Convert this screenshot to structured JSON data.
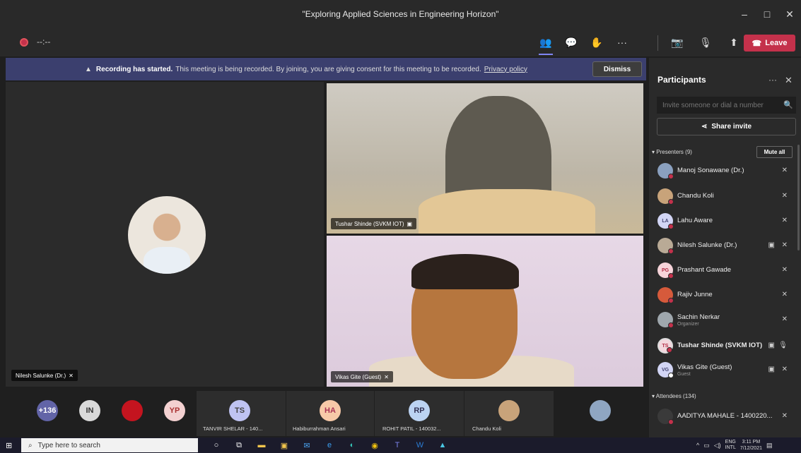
{
  "window": {
    "title": "\"Exploring Applied Sciences in Engineering Horizon\"",
    "minimize": "–",
    "maximize": "□",
    "close": "✕"
  },
  "toolbar": {
    "timer": "--:--",
    "icons": {
      "participants": "👥",
      "chat": "💬",
      "reactions": "✋",
      "more": "···",
      "camera": "📷",
      "mic": "🎙",
      "share": "⬆"
    },
    "leave_label": "Leave"
  },
  "banner": {
    "bold_text": "Recording has started.",
    "text": "This meeting is being recorded. By joining, you are giving consent for this meeting to be recorded.",
    "link": "Privacy policy",
    "dismiss_label": "Dismiss"
  },
  "tiles": {
    "main_name": "Nilesh Salunke (Dr.)",
    "top_right_name": "Tushar Shinde (SVKM IOT)",
    "bottom_right_name": "Vikas Gite (Guest)"
  },
  "strip": {
    "overflow": "+136",
    "in": "IN",
    "yp": "YP",
    "ts": "TS",
    "ha": "HA",
    "rp": "RP",
    "label_ts": "TANVIR SHELAR - 140...",
    "label_ha": "Habiburrahman Ansari",
    "label_rp": "ROHIT PATIL - 140032...",
    "label_ck": "Chandu Koli",
    "colors": {
      "overflow": "#6264a7",
      "in": "#d9d9d9",
      "red": "#c4141f",
      "yp": "#f3d1d1",
      "ts": "#bfc3f2",
      "ha": "#f7c9a8",
      "rp": "#bcd3f2"
    }
  },
  "panel": {
    "title": "Participants",
    "more": "···",
    "close": "✕",
    "invite_placeholder": "Invite someone or dial a number",
    "share_invite": "Share invite",
    "presenters_label": "Presenters (9)",
    "mute_all": "Mute all",
    "attendees_label": "Attendees (134)",
    "presenters": [
      {
        "name": "Manoj Sonawane (Dr.)",
        "initials": "",
        "sub": ""
      },
      {
        "name": "Chandu Koli",
        "initials": "",
        "sub": ""
      },
      {
        "name": "Lahu Aware",
        "initials": "LA",
        "sub": ""
      },
      {
        "name": "Nilesh Salunke (Dr.)",
        "initials": "",
        "sub": ""
      },
      {
        "name": "Prashant Gawade",
        "initials": "PG",
        "sub": ""
      },
      {
        "name": "Rajiv Junne",
        "initials": "",
        "sub": ""
      },
      {
        "name": "Sachin Nerkar",
        "initials": "",
        "sub": "Organizer"
      },
      {
        "name": "Tushar Shinde (SVKM IOT)",
        "initials": "TS",
        "sub": ""
      },
      {
        "name": "Vikas Gite (Guest)",
        "initials": "VG",
        "sub": "Guest"
      }
    ],
    "attendees": [
      {
        "name": "AADITYA MAHALE - 1400220...",
        "initials": ""
      }
    ]
  },
  "taskbar": {
    "search_placeholder": "Type here to search",
    "lang": "ENG",
    "layout": "INTL",
    "time": "3:11 PM",
    "date": "7/12/2021",
    "badge_mail": "43",
    "badge_teams": "9+"
  }
}
